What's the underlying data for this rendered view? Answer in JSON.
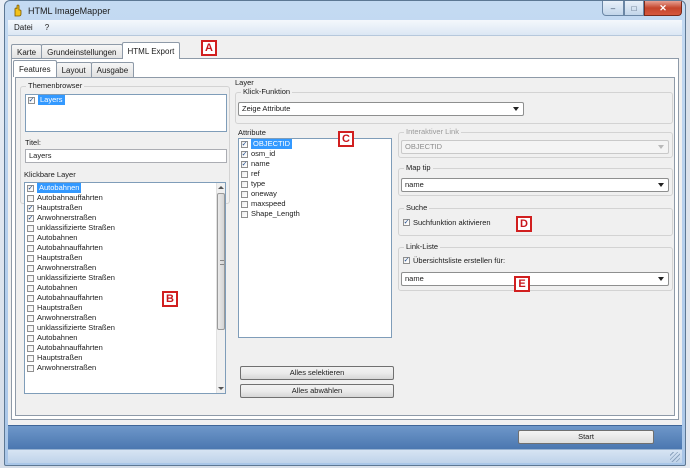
{
  "window": {
    "title": "HTML ImageMapper",
    "controls": {
      "minimize": "–",
      "maximize": "□",
      "close": "✕"
    }
  },
  "menu": [
    "Datei",
    "?"
  ],
  "main_tabs": [
    {
      "label": "Karte",
      "active": false
    },
    {
      "label": "Grundeinstellungen",
      "active": false
    },
    {
      "label": "HTML Export",
      "active": true
    }
  ],
  "sub_tabs": [
    {
      "label": "Features",
      "active": true
    },
    {
      "label": "Layout",
      "active": false
    },
    {
      "label": "Ausgabe",
      "active": false
    }
  ],
  "themenbrowser": {
    "label": "Themenbrowser",
    "items": [
      {
        "label": "Layers",
        "checked": true,
        "selected": true
      }
    ]
  },
  "titel": {
    "label": "Titel:",
    "value": "Layers"
  },
  "klickbare_layer": {
    "label": "Klickbare Layer",
    "items": [
      {
        "label": "Autobahnen",
        "checked": true,
        "selected": true
      },
      {
        "label": "Autobahnauffahrten",
        "checked": false,
        "selected": false
      },
      {
        "label": "Hauptstraßen",
        "checked": true,
        "selected": false
      },
      {
        "label": "Anwohnerstraßen",
        "checked": true,
        "selected": false
      },
      {
        "label": "unklassifizierte Straßen",
        "checked": false,
        "selected": false
      },
      {
        "label": "Autobahnen",
        "checked": false,
        "selected": false
      },
      {
        "label": "Autobahnauffahrten",
        "checked": false,
        "selected": false
      },
      {
        "label": "Hauptstraßen",
        "checked": false,
        "selected": false
      },
      {
        "label": "Anwohnerstraßen",
        "checked": false,
        "selected": false
      },
      {
        "label": "unklassifizierte Straßen",
        "checked": false,
        "selected": false
      },
      {
        "label": "Autobahnen",
        "checked": false,
        "selected": false
      },
      {
        "label": "Autobahnauffahrten",
        "checked": false,
        "selected": false
      },
      {
        "label": "Hauptstraßen",
        "checked": false,
        "selected": false
      },
      {
        "label": "Anwohnerstraßen",
        "checked": false,
        "selected": false
      },
      {
        "label": "unklassifizierte Straßen",
        "checked": false,
        "selected": false
      },
      {
        "label": "Autobahnen",
        "checked": false,
        "selected": false
      },
      {
        "label": "Autobahnauffahrten",
        "checked": false,
        "selected": false
      },
      {
        "label": "Hauptstraßen",
        "checked": false,
        "selected": false
      },
      {
        "label": "Anwohnerstraßen",
        "checked": false,
        "selected": false
      }
    ]
  },
  "layer": {
    "label": "Layer",
    "klick_funktion": {
      "label": "Klick-Funktion",
      "value": "Zeige Attribute"
    }
  },
  "attribute": {
    "label": "Attribute",
    "items": [
      {
        "label": "OBJECTID",
        "checked": true,
        "selected": true
      },
      {
        "label": "osm_id",
        "checked": true,
        "selected": false
      },
      {
        "label": "name",
        "checked": true,
        "selected": false
      },
      {
        "label": "ref",
        "checked": false,
        "selected": false
      },
      {
        "label": "type",
        "checked": false,
        "selected": false
      },
      {
        "label": "oneway",
        "checked": false,
        "selected": false
      },
      {
        "label": "maxspeed",
        "checked": false,
        "selected": false
      },
      {
        "label": "Shape_Length",
        "checked": false,
        "selected": false
      }
    ],
    "select_all": "Alles selektieren",
    "deselect_all": "Alles abwählen"
  },
  "interaktiver_link": {
    "label": "Interaktiver Link",
    "value": "OBJECTID"
  },
  "map_tip": {
    "label": "Map tip",
    "value": "name"
  },
  "suche": {
    "label": "Suche",
    "checkbox": "Suchfunktion aktivieren",
    "checked": true
  },
  "link_liste": {
    "label": "Link-Liste",
    "checkbox": "Übersichtsliste erstellen für:",
    "checked": true,
    "value": "name"
  },
  "start_button": "Start",
  "markers": [
    "A",
    "B",
    "C",
    "D",
    "E"
  ],
  "colors": {
    "selection": "#3399ff",
    "marker": "#d11f1f",
    "bottom_bar": "#4b77b0"
  }
}
